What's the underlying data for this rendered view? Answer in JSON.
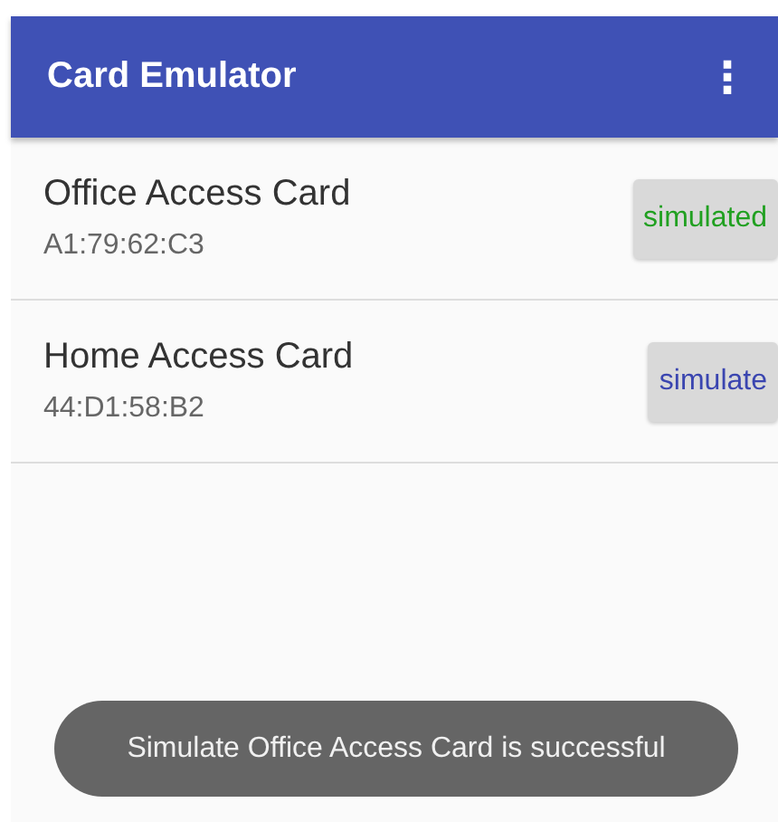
{
  "app_bar": {
    "title": "Card Emulator",
    "menu_icon": "⋮"
  },
  "cards": [
    {
      "name": "Office Access Card",
      "uid": "A1:79:62:C3",
      "button": "simulated",
      "active": true
    },
    {
      "name": "Home Access Card",
      "uid": "44:D1:58:B2",
      "button": "simulate",
      "active": false
    }
  ],
  "toast": "Simulate Office Access Card is successful"
}
